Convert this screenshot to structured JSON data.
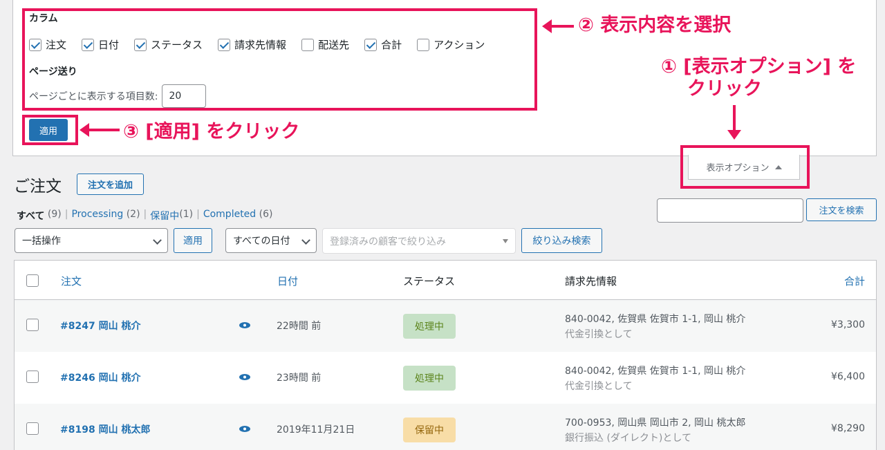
{
  "screen_options": {
    "columns_heading": "カラム",
    "columns": [
      {
        "label": "注文",
        "checked": true
      },
      {
        "label": "日付",
        "checked": true
      },
      {
        "label": "ステータス",
        "checked": true
      },
      {
        "label": "請求先情報",
        "checked": true
      },
      {
        "label": "配送先",
        "checked": false
      },
      {
        "label": "合計",
        "checked": true
      },
      {
        "label": "アクション",
        "checked": false
      }
    ],
    "paging_heading": "ページ送り",
    "per_page_label": "ページごとに表示する項目数:",
    "per_page_value": "20",
    "apply_label": "適用",
    "tab_label": "表示オプション"
  },
  "annotations": {
    "step1_line1": "① [表示オプション] を",
    "step1_line2": "クリック",
    "step2": "② 表示内容を選択",
    "step3": "③ [適用] をクリック",
    "color": "#e8145a"
  },
  "header": {
    "title": "ご注文",
    "add_button": "注文を追加"
  },
  "filters": {
    "all_label": "すべて",
    "all_count": "(9)",
    "processing_label": "Processing",
    "processing_count": "(2)",
    "onhold_label": "保留中",
    "onhold_count": "(1)",
    "completed_label": "Completed",
    "completed_count": "(6)",
    "search_button": "注文を検索",
    "bulk_action": "一括操作",
    "bulk_apply": "適用",
    "date_filter": "すべての日付",
    "customer_placeholder": "登録済みの顧客で絞り込み",
    "filter_button": "絞り込み検索"
  },
  "table": {
    "headers": {
      "order": "注文",
      "date": "日付",
      "status": "ステータス",
      "billing": "請求先情報",
      "total": "合計"
    },
    "rows": [
      {
        "order": "#8247 岡山 桃介",
        "date": "22時間 前",
        "status": "処理中",
        "status_type": "processing",
        "address": "840-0042, 佐賀県 佐賀市 1-1, 岡山 桃介",
        "payment": "代金引換として",
        "total": "¥3,300"
      },
      {
        "order": "#8246 岡山 桃介",
        "date": "23時間 前",
        "status": "処理中",
        "status_type": "processing",
        "address": "840-0042, 佐賀県 佐賀市 1-1, 岡山 桃介",
        "payment": "代金引換として",
        "total": "¥6,400"
      },
      {
        "order": "#8198 岡山 桃太郎",
        "date": "2019年11月21日",
        "status": "保留中",
        "status_type": "onhold",
        "address": "700-0953, 岡山県 岡山市 2, 岡山 桃太郎",
        "payment": "銀行振込 (ダイレクト)として",
        "total": "¥8,290"
      }
    ]
  }
}
